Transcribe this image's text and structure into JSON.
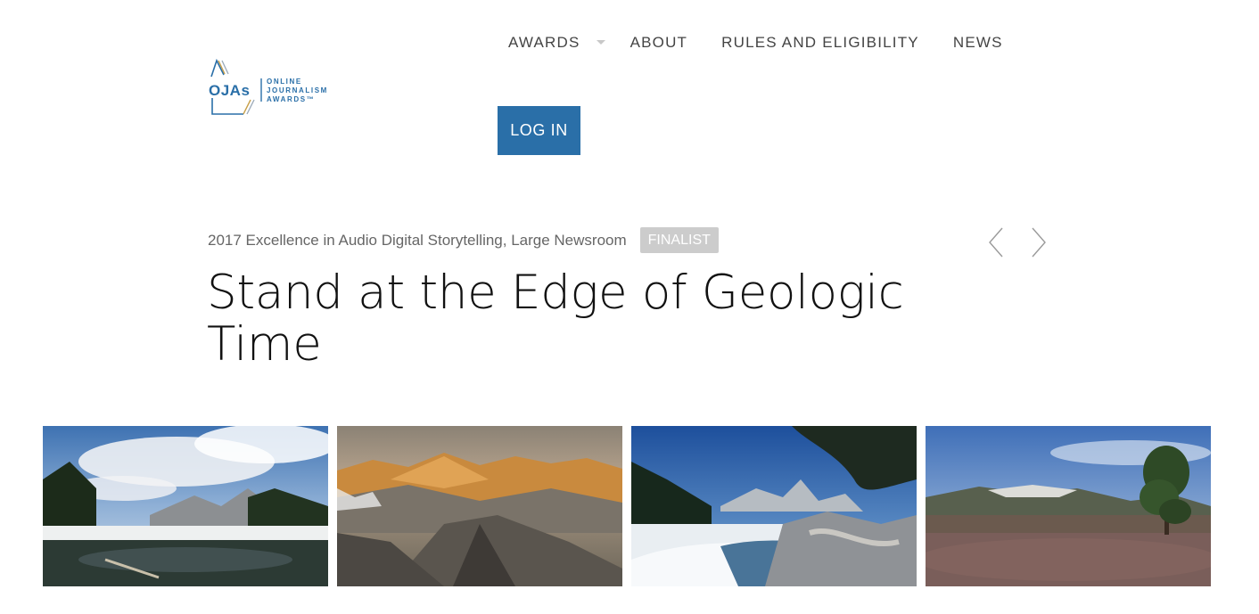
{
  "logo": {
    "mark": "OJAs",
    "line1": "ONLINE",
    "line2": "JOURNALISM",
    "line3": "AWARDS™",
    "color": "#2a6fa8",
    "accent": "#c8a04a"
  },
  "nav": {
    "items": [
      {
        "label": "AWARDS",
        "has_dropdown": true
      },
      {
        "label": "ABOUT"
      },
      {
        "label": "RULES AND ELIGIBILITY"
      },
      {
        "label": "NEWS"
      }
    ],
    "login_label": "LOG IN",
    "login_color": "#2a6fa8"
  },
  "entry": {
    "category": "2017 Excellence in Audio Digital Storytelling, Large Newsroom",
    "badge": "FINALIST",
    "title": "Stand at the Edge of Geologic Time",
    "prev_icon": "chevron-left-icon",
    "next_icon": "chevron-right-icon"
  },
  "gallery": {
    "images": [
      {
        "name": "alpine-lake-snow-photo"
      },
      {
        "name": "sunset-mountain-ridge-photo"
      },
      {
        "name": "frozen-lake-tree-roots-photo"
      },
      {
        "name": "meadow-pine-tree-photo"
      }
    ]
  }
}
